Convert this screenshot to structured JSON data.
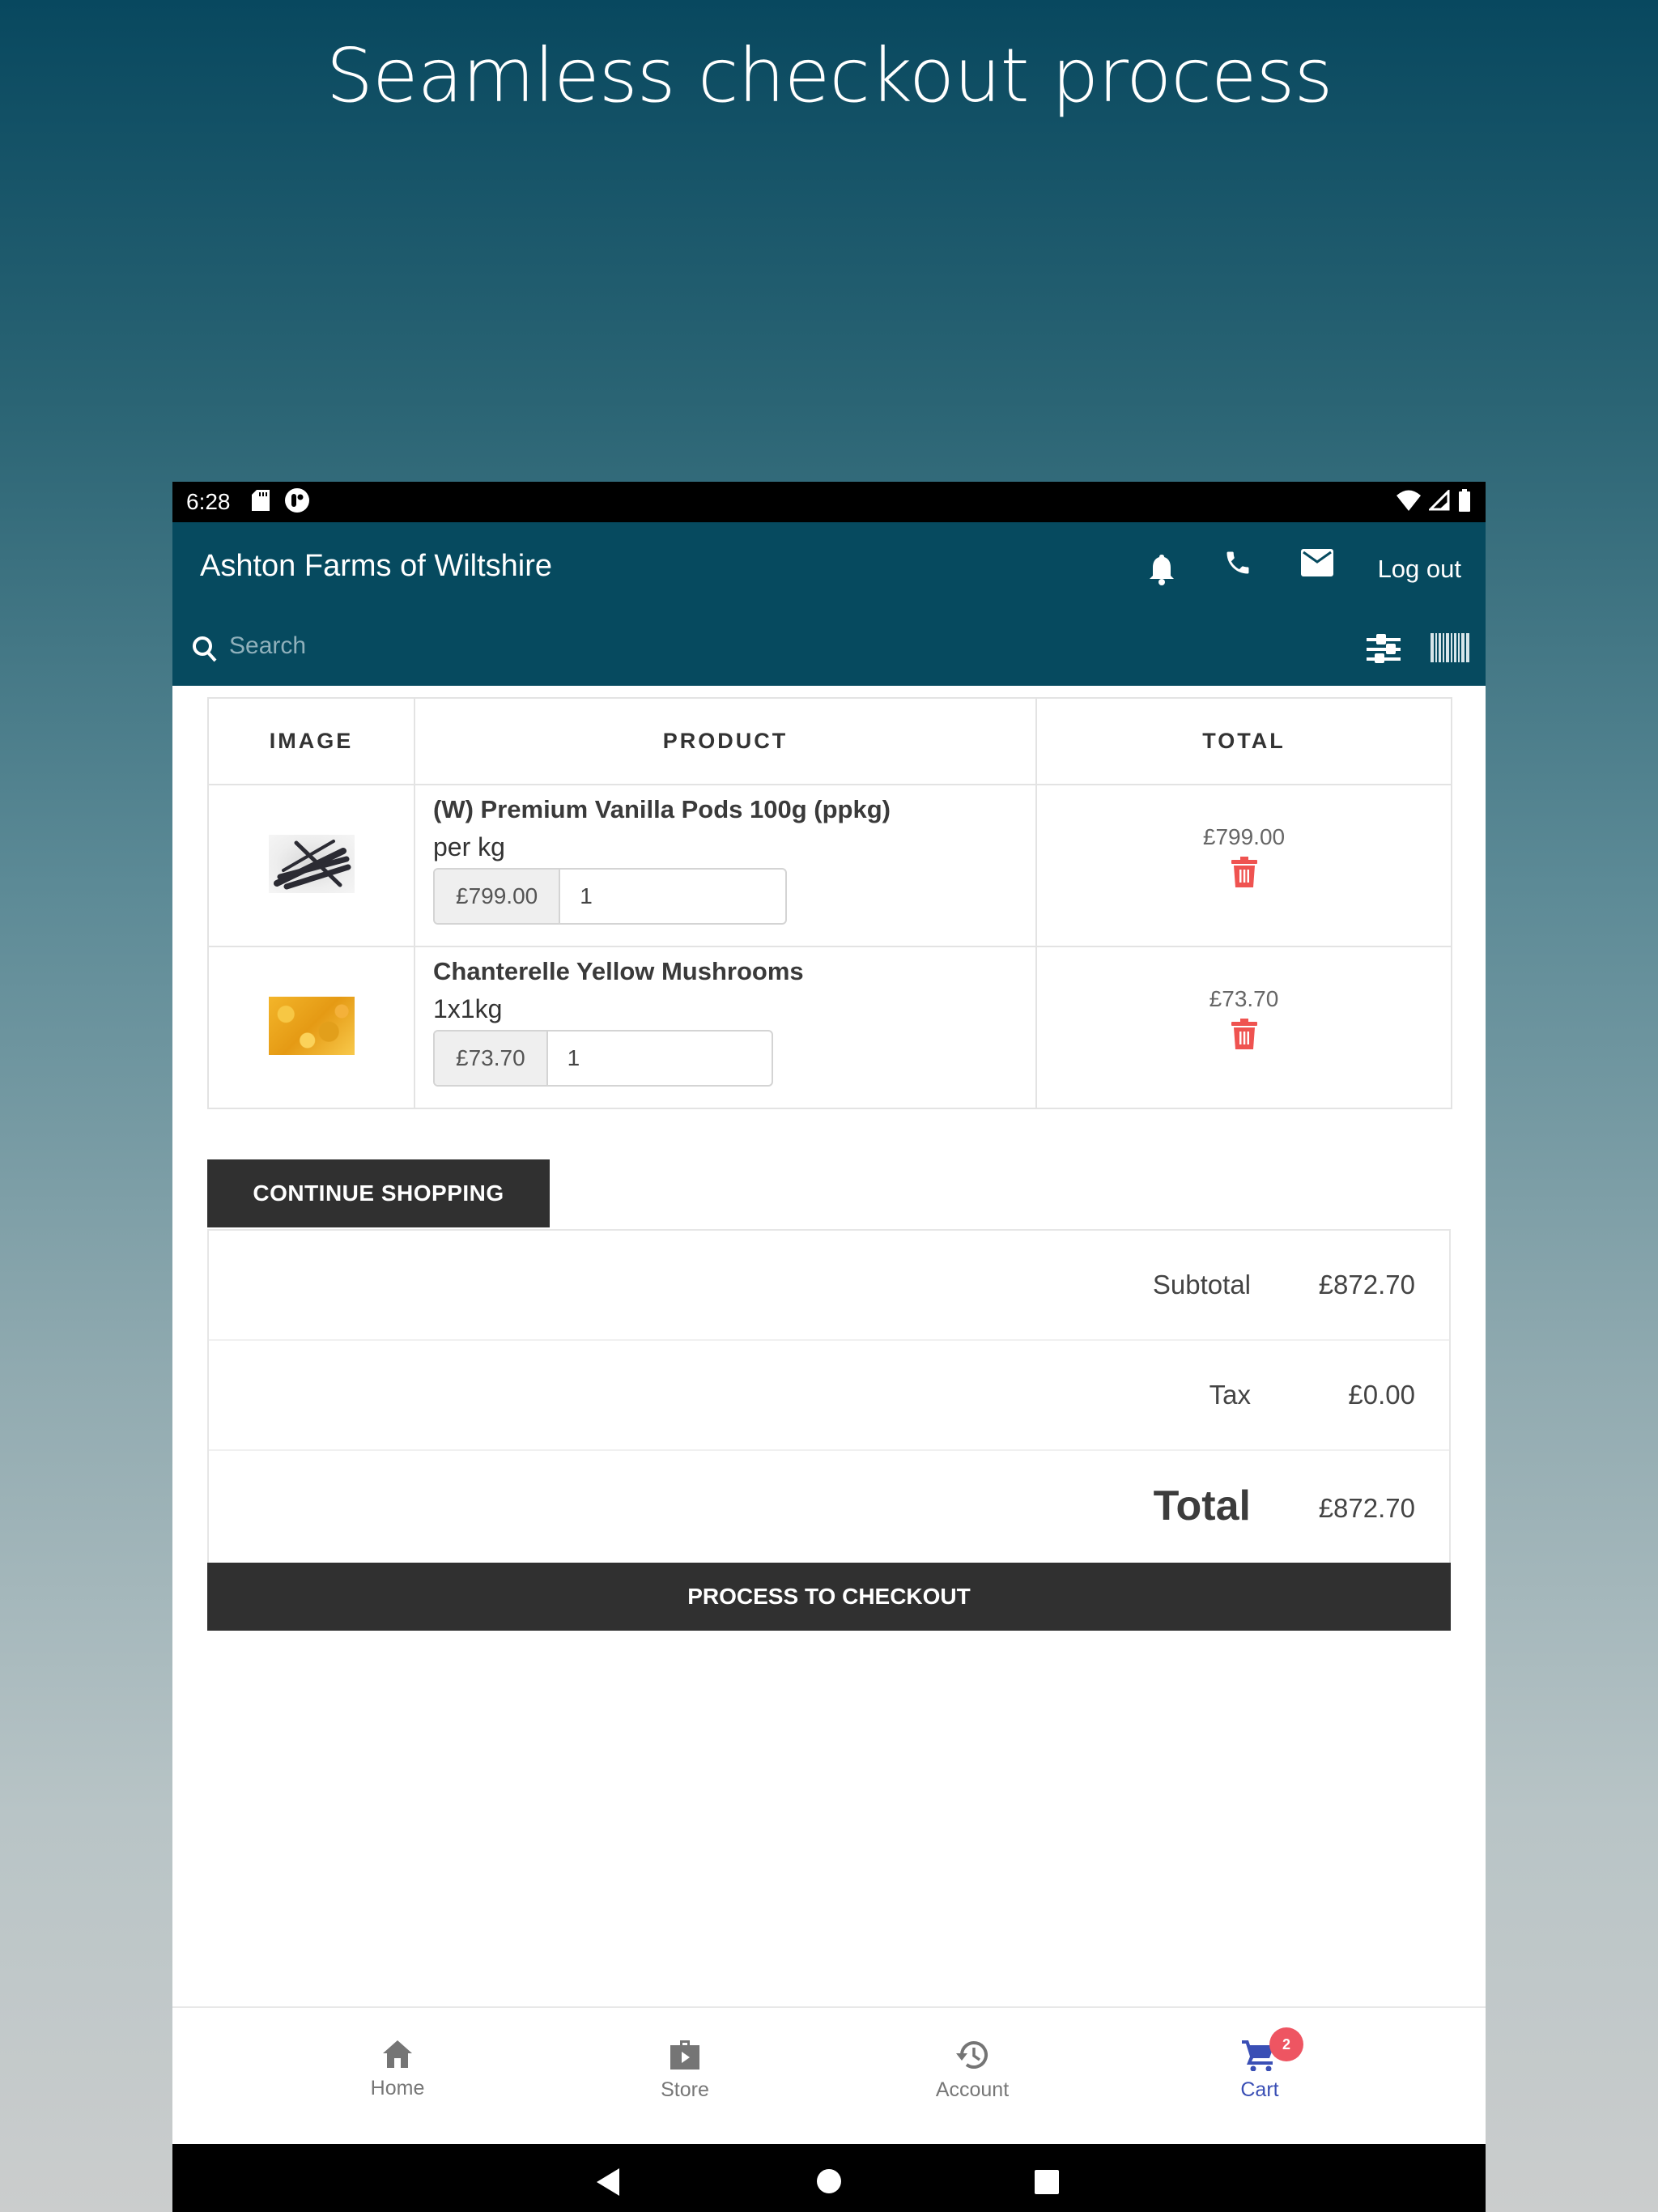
{
  "promo": {
    "title": "Seamless checkout process"
  },
  "status_bar": {
    "time": "6:28",
    "left_icons": [
      "sd-card-icon",
      "app-notification-icon"
    ],
    "right_icons": [
      "wifi-icon",
      "signal-icon",
      "battery-icon"
    ]
  },
  "header": {
    "title": "Ashton Farms of Wiltshire",
    "icons": [
      "bell-icon",
      "phone-icon",
      "mail-icon"
    ],
    "logout_label": "Log out",
    "search": {
      "placeholder": "Search",
      "value": ""
    },
    "search_tools": [
      "filter-sliders-icon",
      "barcode-scanner-icon"
    ]
  },
  "cart": {
    "columns": [
      "IMAGE",
      "PRODUCT",
      "TOTAL"
    ],
    "items": [
      {
        "name": "(W) Premium Vanilla Pods 100g (ppkg)",
        "unit": "per kg",
        "unit_price": "£799.00",
        "quantity": "1",
        "line_total": "£799.00",
        "image": "vanilla-pods"
      },
      {
        "name": "Chanterelle Yellow Mushrooms",
        "unit": "1x1kg",
        "unit_price": "£73.70",
        "quantity": "1",
        "line_total": "£73.70",
        "image": "chanterelle-mushrooms"
      }
    ],
    "continue_label": "CONTINUE SHOPPING"
  },
  "summary": {
    "subtotal_label": "Subtotal",
    "subtotal": "£872.70",
    "tax_label": "Tax",
    "tax": "£0.00",
    "total_label": "Total",
    "total": "£872.70",
    "checkout_label": "PROCESS TO CHECKOUT"
  },
  "bottom_nav": {
    "items": [
      {
        "label": "Home",
        "icon": "home-icon",
        "active": false
      },
      {
        "label": "Store",
        "icon": "store-bag-icon",
        "active": false
      },
      {
        "label": "Account",
        "icon": "history-icon",
        "active": false
      },
      {
        "label": "Cart",
        "icon": "cart-icon",
        "active": true,
        "badge": "2"
      }
    ]
  },
  "colors": {
    "header_bg": "#064a5f",
    "button_dark": "#303030",
    "delete_red": "#ef5350",
    "active_nav": "#3a4fb5",
    "badge_red": "#ee5562"
  }
}
